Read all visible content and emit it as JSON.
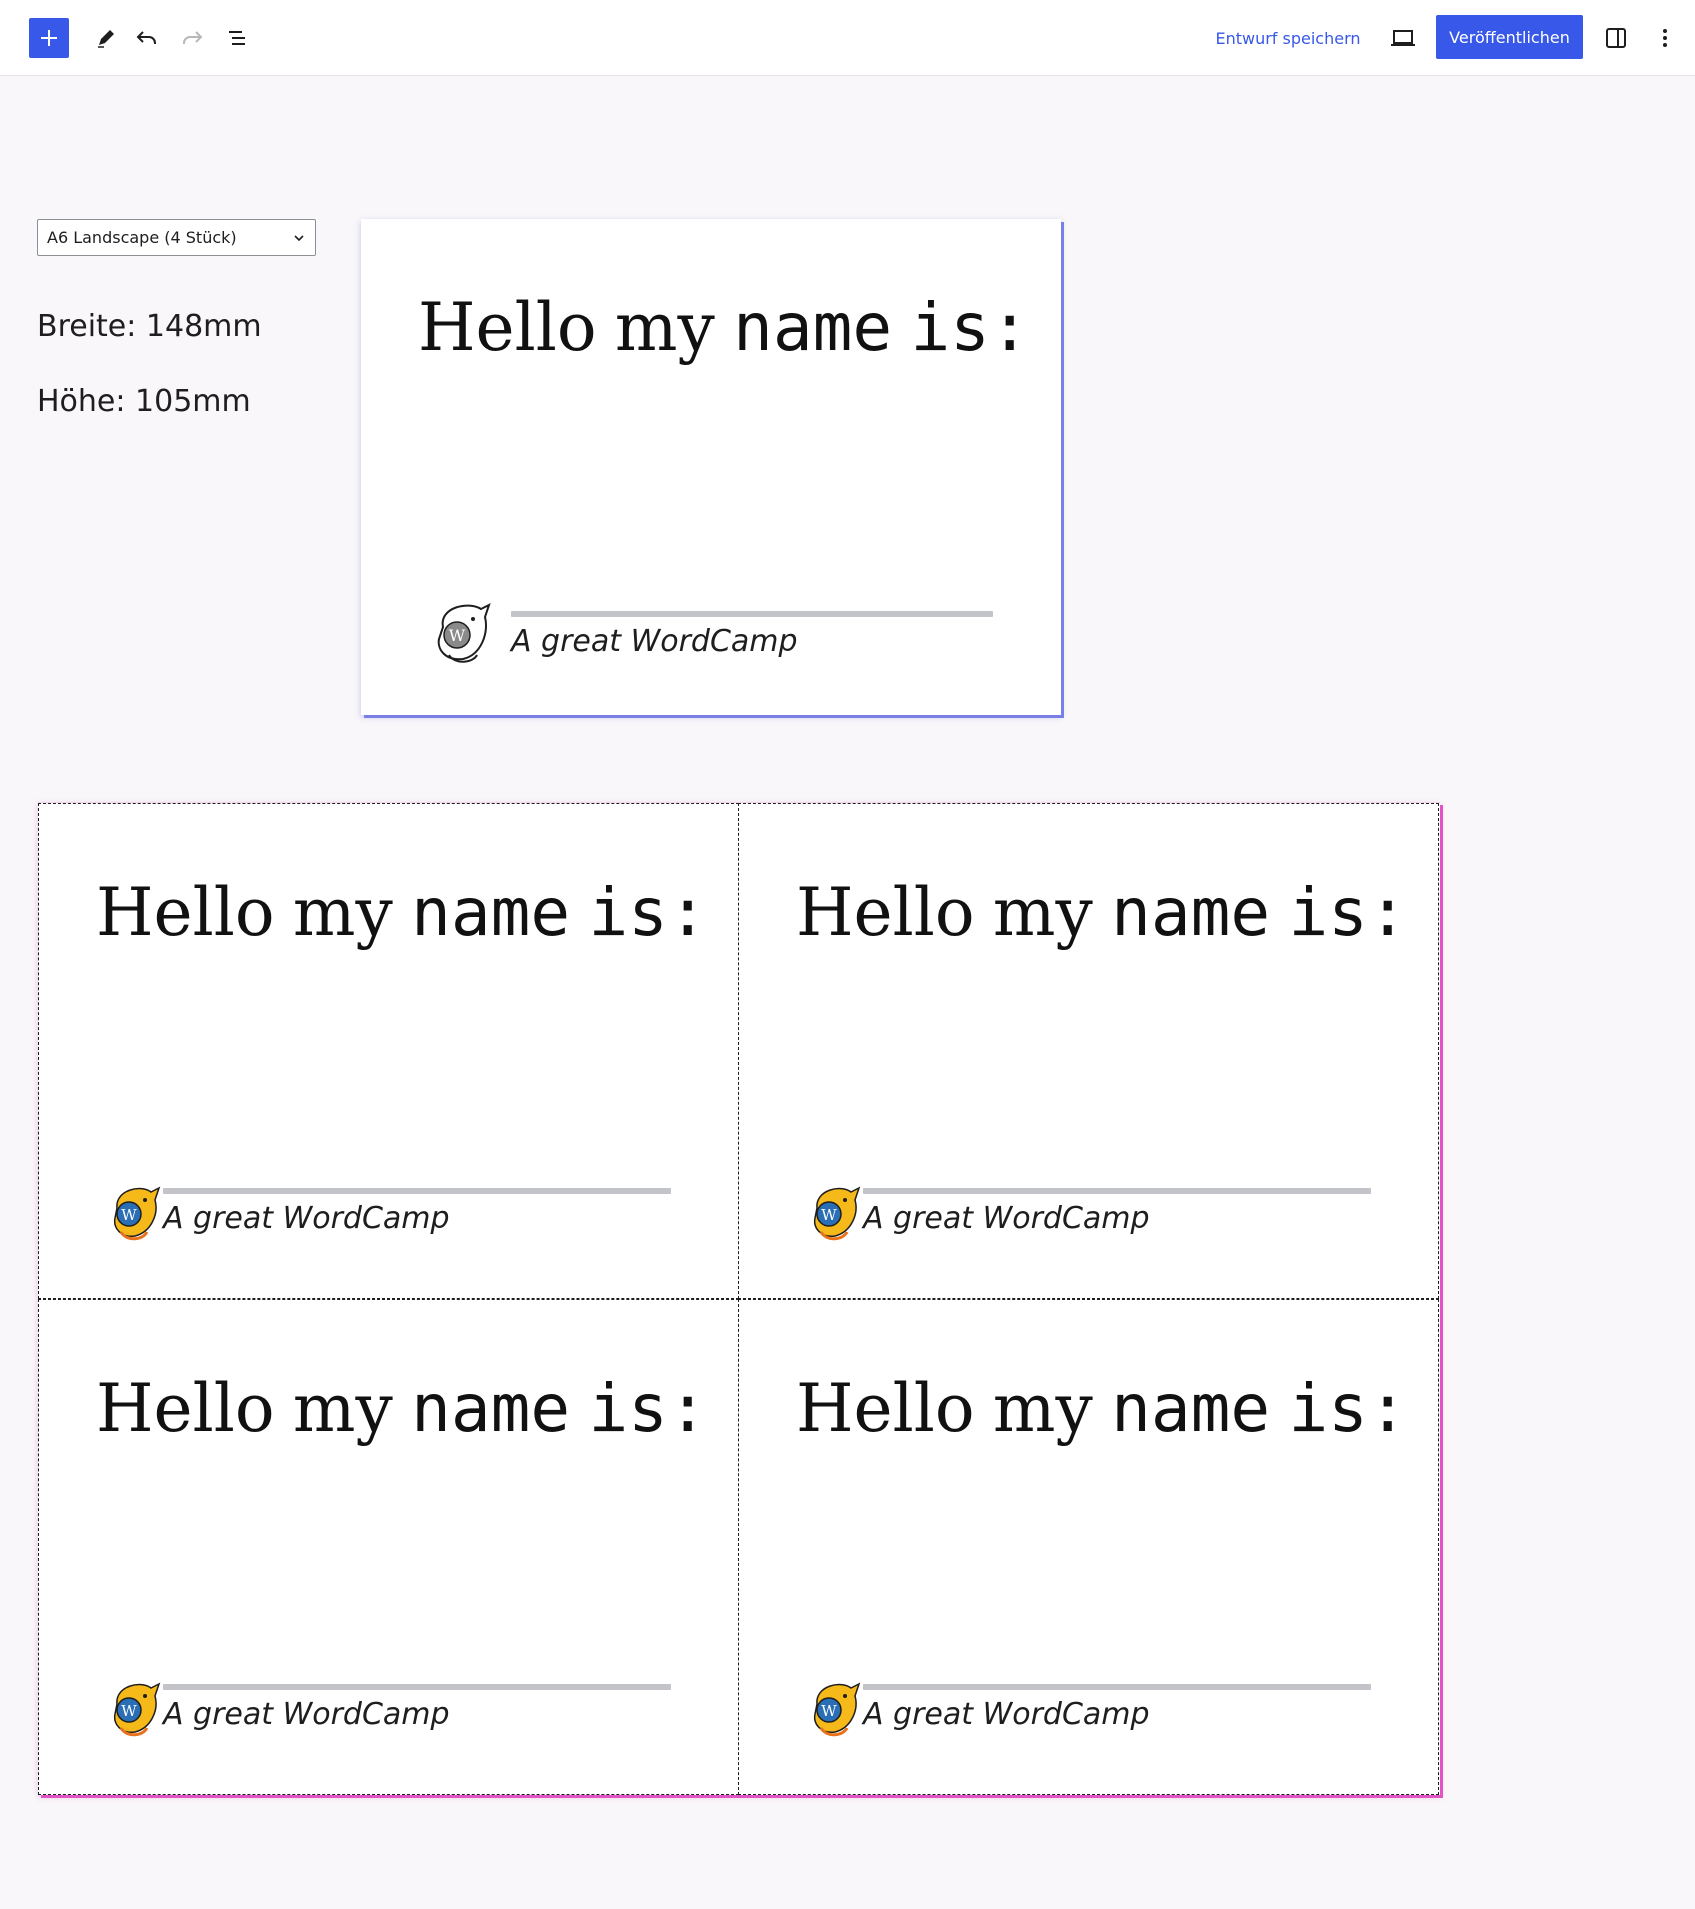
{
  "toolbar": {
    "add_icon": "plus-icon",
    "tools_icon": "pencil-icon",
    "undo_icon": "undo-icon",
    "redo_icon": "redo-icon",
    "outline_icon": "list-view-icon",
    "save_draft_label": "Entwurf speichern",
    "preview_icon": "laptop-icon",
    "publish_label": "Veröffentlichen",
    "settings_icon": "sidebar-icon",
    "options_icon": "more-vertical-icon",
    "accent_color": "#3858e9"
  },
  "layout_panel": {
    "format_selected": "A6 Landscape (4 Stück)",
    "width_text": "Breite: 148mm",
    "height_text": "Höhe: 105mm"
  },
  "badge": {
    "greeting_word1": "Hello",
    "greeting_word2": "my",
    "greeting_word3": "name",
    "greeting_word4": "is:",
    "tagline": "A great WordCamp"
  },
  "sheet": {
    "preview_border_color": "#7a7fe8",
    "sheet_border_color": "#e254c6"
  }
}
